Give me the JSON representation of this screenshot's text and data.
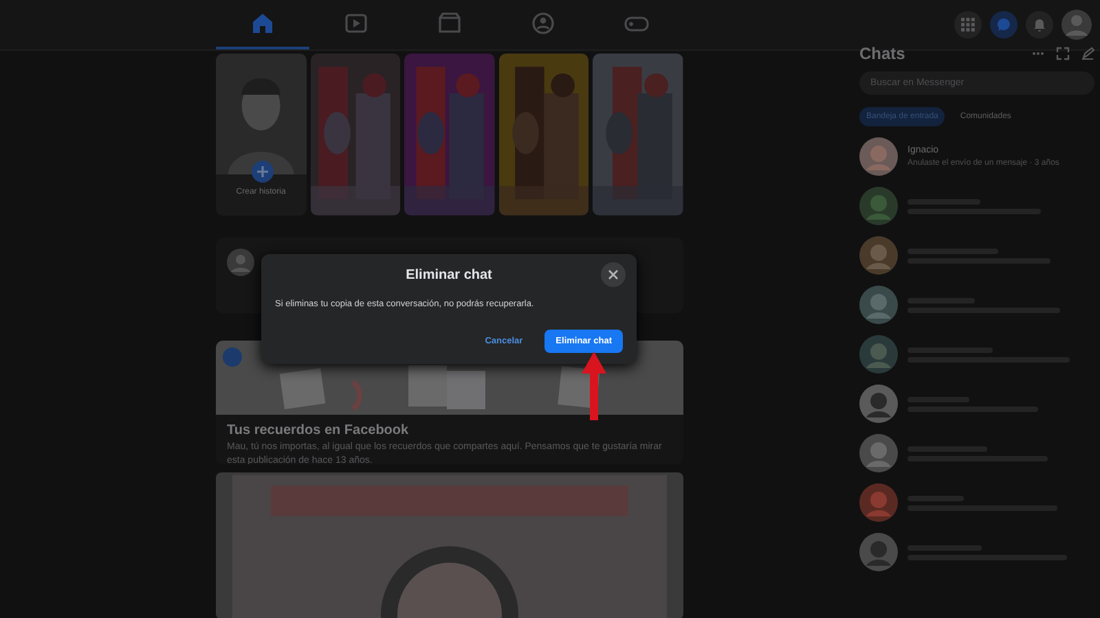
{
  "top_nav": {
    "tabs": [
      {
        "kind": "home",
        "selected": true
      },
      {
        "kind": "video",
        "selected": false
      },
      {
        "kind": "store",
        "selected": false
      },
      {
        "kind": "groups",
        "selected": false
      },
      {
        "kind": "gaming",
        "selected": false
      }
    ]
  },
  "stories": [
    {
      "kind": "create",
      "label": "Crear historia"
    },
    {
      "kind": "picture"
    },
    {
      "kind": "picture"
    },
    {
      "kind": "picture"
    },
    {
      "kind": "picture"
    }
  ],
  "memories": {
    "title": "Tus recuerdos en Facebook",
    "text": "Mau, tú nos importas, al igual que los recuerdos que compartes aquí. Pensamos que te gustaría mirar esta publicación de hace 13 años."
  },
  "chats": {
    "title": "Chats",
    "search": {
      "placeholder": "Buscar en Messenger"
    },
    "tabs": [
      {
        "label": "Bandeja de entrada",
        "selected": true
      },
      {
        "label": "Comunidades",
        "selected": false
      }
    ],
    "items": [
      {
        "kind": "named",
        "name": "Ignacio",
        "preview": "Anulaste el envío de un mensaje · 3 años"
      },
      {
        "kind": "blurred"
      },
      {
        "kind": "blurred"
      },
      {
        "kind": "blurred"
      },
      {
        "kind": "blurred"
      },
      {
        "kind": "blurred"
      },
      {
        "kind": "blurred"
      },
      {
        "kind": "blurred"
      },
      {
        "kind": "blurred"
      }
    ]
  },
  "dialog": {
    "title": "Eliminar chat",
    "message": "Si eliminas tu copia de esta conversación, no podrás recuperarla.",
    "buttons": [
      {
        "kind": "secondary",
        "label": "Cancelar"
      },
      {
        "kind": "primary",
        "label": "Eliminar chat"
      }
    ]
  }
}
